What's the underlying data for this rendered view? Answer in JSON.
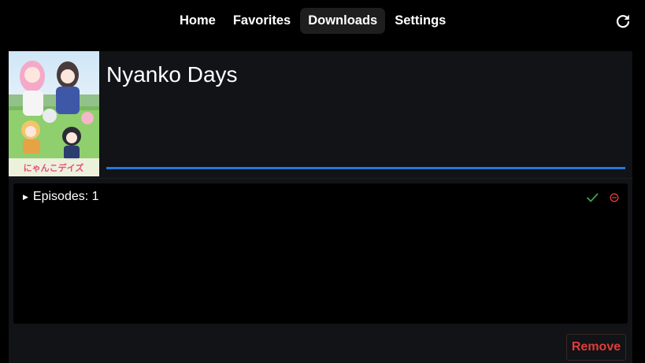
{
  "nav": {
    "items": [
      {
        "label": "Home",
        "active": false
      },
      {
        "label": "Favorites",
        "active": false
      },
      {
        "label": "Downloads",
        "active": true
      },
      {
        "label": "Settings",
        "active": false
      }
    ],
    "refresh_icon": "refresh-icon"
  },
  "anime": {
    "title": "Nyanko Days",
    "poster_logo_text": "にゃんこデイズ",
    "progress": 1.0
  },
  "episodes": {
    "label": "Episodes: 1",
    "status_icon": "check-icon",
    "status_color": "#3fa34d",
    "remove_icon": "minus-circle-icon",
    "remove_icon_color": "#e23b3b"
  },
  "actions": {
    "remove_label": "Remove"
  },
  "colors": {
    "accent": "#2677d9",
    "danger": "#e23b3b",
    "card_bg": "#111316"
  }
}
